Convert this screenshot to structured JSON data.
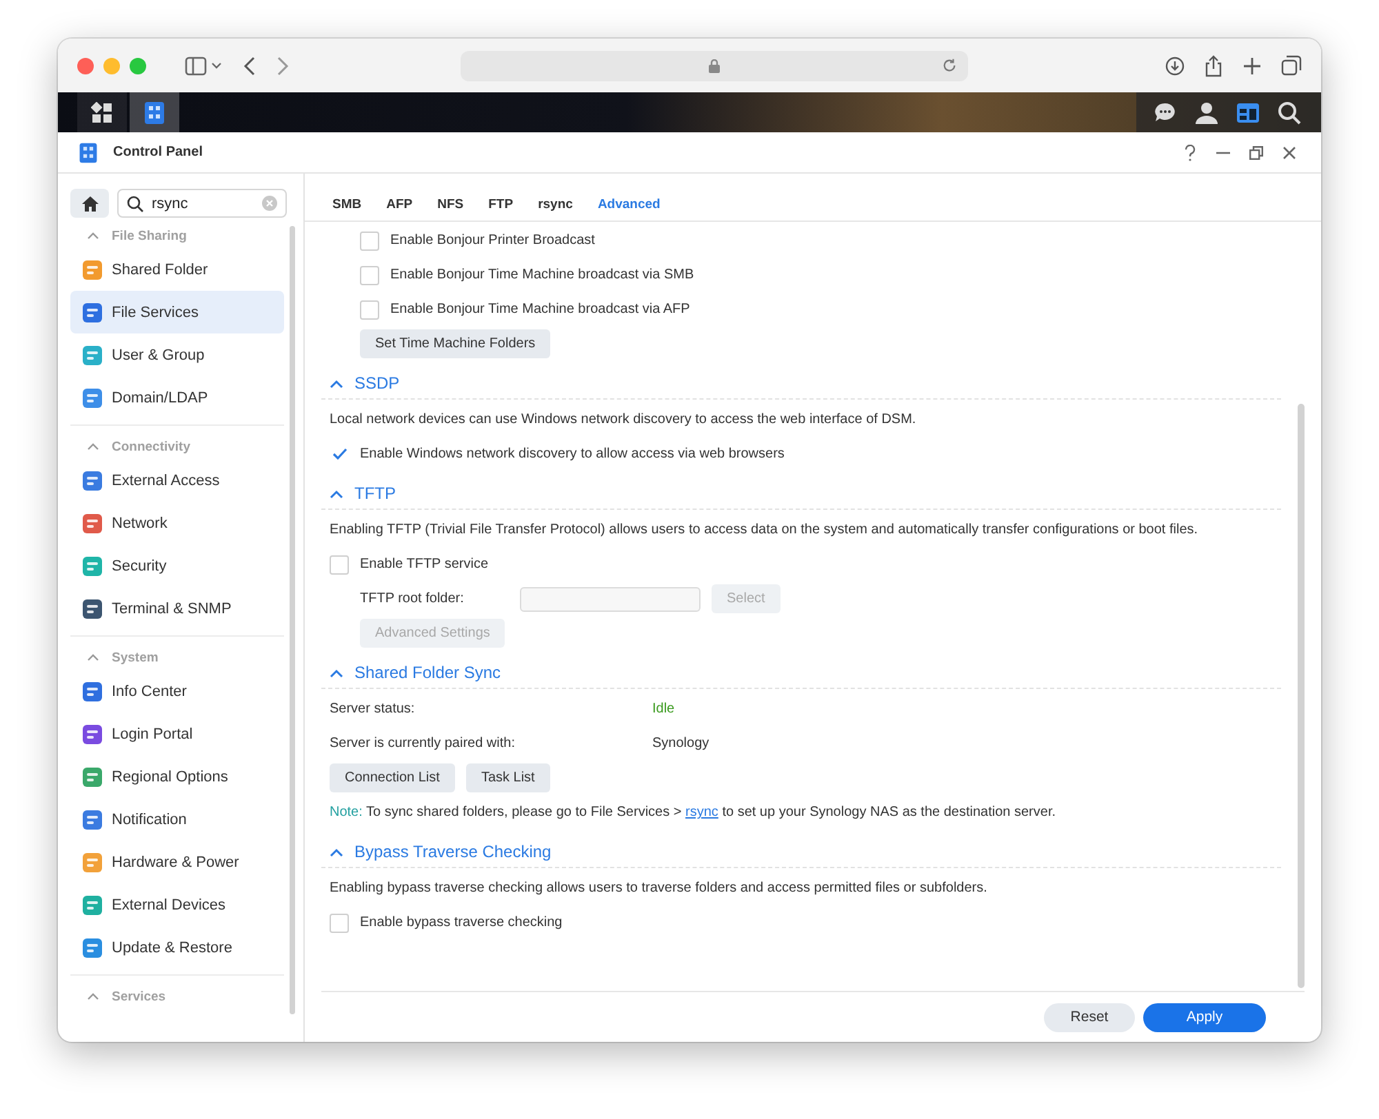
{
  "window": {
    "title": "Control Panel"
  },
  "sidebar": {
    "search": {
      "value": "rsync"
    },
    "groups": [
      {
        "label": "File Sharing",
        "expanded": true,
        "items": [
          {
            "label": "Shared Folder",
            "selected": false
          },
          {
            "label": "File Services",
            "selected": true
          },
          {
            "label": "User & Group",
            "selected": false
          },
          {
            "label": "Domain/LDAP",
            "selected": false
          }
        ]
      },
      {
        "label": "Connectivity",
        "expanded": true,
        "items": [
          {
            "label": "External Access",
            "selected": false
          },
          {
            "label": "Network",
            "selected": false
          },
          {
            "label": "Security",
            "selected": false
          },
          {
            "label": "Terminal & SNMP",
            "selected": false
          }
        ]
      },
      {
        "label": "System",
        "expanded": true,
        "items": [
          {
            "label": "Info Center",
            "selected": false
          },
          {
            "label": "Login Portal",
            "selected": false
          },
          {
            "label": "Regional Options",
            "selected": false
          },
          {
            "label": "Notification",
            "selected": false
          },
          {
            "label": "Hardware & Power",
            "selected": false
          },
          {
            "label": "External Devices",
            "selected": false
          },
          {
            "label": "Update & Restore",
            "selected": false
          }
        ]
      },
      {
        "label": "Services",
        "expanded": true
      }
    ]
  },
  "tabs": [
    {
      "label": "SMB",
      "selected": false
    },
    {
      "label": "AFP",
      "selected": false
    },
    {
      "label": "NFS",
      "selected": false
    },
    {
      "label": "FTP",
      "selected": false
    },
    {
      "label": "rsync",
      "selected": false
    },
    {
      "label": "Advanced",
      "selected": true
    }
  ],
  "top_rows": [
    {
      "kind": "checkbox",
      "label": "Enable Bonjour Printer Broadcast",
      "checked": false,
      "indented": true
    },
    {
      "kind": "checkbox",
      "label": "Enable Bonjour Time Machine broadcast via SMB",
      "checked": false,
      "indented": true
    },
    {
      "kind": "checkbox",
      "label": "Enable Bonjour Time Machine broadcast via AFP",
      "checked": false,
      "indented": true
    },
    {
      "kind": "button",
      "label": "Set Time Machine Folders",
      "disabled": false,
      "indented": true
    }
  ],
  "sections": [
    {
      "title": "SSDP",
      "expanded": true,
      "rows": [
        {
          "kind": "text",
          "text": "Local network devices can use Windows network discovery to access the web interface of DSM."
        },
        {
          "kind": "checkbox",
          "label": "Enable Windows network discovery to allow access via web browsers",
          "checked": true,
          "indented": false
        }
      ]
    },
    {
      "title": "TFTP",
      "expanded": true,
      "rows": [
        {
          "kind": "text",
          "text": "Enabling TFTP (Trivial File Transfer Protocol) allows users to access data on the system and automatically transfer configurations or boot files."
        },
        {
          "kind": "checkbox",
          "label": "Enable TFTP service",
          "checked": false,
          "indented": false
        },
        {
          "kind": "field",
          "label": "TFTP root folder:",
          "disabled": true,
          "button": "Select",
          "indented": true
        },
        {
          "kind": "button",
          "label": "Advanced Settings",
          "disabled": true,
          "indented": true
        }
      ]
    },
    {
      "title": "Shared Folder Sync",
      "expanded": true,
      "rows": [
        {
          "kind": "info",
          "label": "Server status:",
          "value": "Idle",
          "color": "#3a9a1e"
        },
        {
          "kind": "info",
          "label": "Server is currently paired with:",
          "value": "Synology",
          "color": "#333333"
        },
        {
          "kind": "buttons",
          "buttons": [
            "Connection List",
            "Task List"
          ]
        },
        {
          "kind": "note",
          "prefix": "Note:",
          "before": "To sync shared folders, please go to File Services >",
          "link": "rsync",
          "after": "to set up your Synology NAS as the destination server."
        }
      ]
    },
    {
      "title": "Bypass Traverse Checking",
      "expanded": true,
      "rows": [
        {
          "kind": "text",
          "text": "Enabling bypass traverse checking allows users to traverse folders and access permitted files or subfolders."
        },
        {
          "kind": "checkbox",
          "label": "Enable bypass traverse checking",
          "checked": false,
          "indented": false
        }
      ]
    }
  ],
  "footer": [
    {
      "label": "Reset",
      "kind": "secondary"
    },
    {
      "label": "Apply",
      "kind": "primary"
    }
  ]
}
